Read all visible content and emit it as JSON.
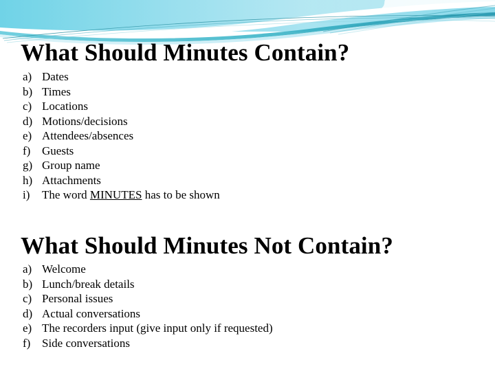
{
  "slide": {
    "background_color": "#ffffff",
    "decoration": {
      "name": "wave-header-graphic",
      "colors": {
        "gradient_start": "#7ad5e8",
        "gradient_end": "#a8e3ef",
        "wave_teal": "#3ab8c9",
        "wave_light": "#b5e6f0",
        "wave_pale": "#d6f1f7",
        "hairline": "#2d8f9e",
        "white": "#ffffff"
      }
    },
    "sections": [
      {
        "id": "contain",
        "title": "What Should Minutes Contain?",
        "items": [
          {
            "marker": "a)",
            "text": "Dates"
          },
          {
            "marker": "b)",
            "text": "Times"
          },
          {
            "marker": "c)",
            "text": "Locations"
          },
          {
            "marker": "d)",
            "text": "Motions/decisions"
          },
          {
            "marker": "e)",
            "text": "Attendees/absences"
          },
          {
            "marker": "f)",
            "text": "Guests"
          },
          {
            "marker": "g)",
            "text": "Group name"
          },
          {
            "marker": "h)",
            "text": "Attachments"
          },
          {
            "marker": "i)",
            "text": "The word MINUTES has to be shown",
            "underline": "MINUTES"
          }
        ]
      },
      {
        "id": "not-contain",
        "title": "What Should Minutes Not Contain?",
        "items": [
          {
            "marker": "a)",
            "text": "Welcome"
          },
          {
            "marker": "b)",
            "text": "Lunch/break details"
          },
          {
            "marker": "c)",
            "text": "Personal issues"
          },
          {
            "marker": "d)",
            "text": "Actual conversations"
          },
          {
            "marker": "e)",
            "text": "The recorders input (give input only if requested)"
          },
          {
            "marker": "f)",
            "text": "Side conversations"
          }
        ]
      }
    ]
  }
}
